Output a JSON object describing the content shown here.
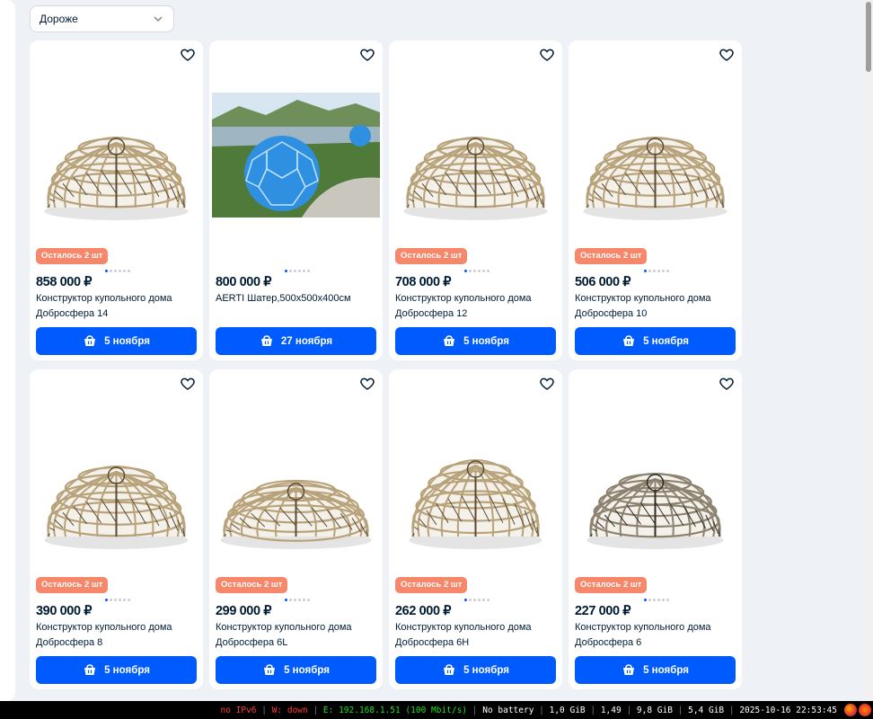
{
  "sort": {
    "selected": "Дороже"
  },
  "products": [
    {
      "price": "858 000 ₽",
      "title": "Конструктор купольного дома Добросфера 14",
      "badge": "Осталось 2 шт",
      "delivery": "5 ноября",
      "image": "dome-frame"
    },
    {
      "price": "800 000 ₽",
      "title": "AERTI Шатер,500x500x400см",
      "badge": "",
      "delivery": "27 ноября",
      "image": "glass-dome-photo"
    },
    {
      "price": "708 000 ₽",
      "title": "Конструктор купольного дома Добросфера 12",
      "badge": "Осталось 2 шт",
      "delivery": "5 ноября",
      "image": "dome-frame"
    },
    {
      "price": "506 000 ₽",
      "title": "Конструктор купольного дома Добросфера 10",
      "badge": "Осталось 2 шт",
      "delivery": "5 ноября",
      "image": "dome-frame"
    },
    {
      "price": "390 000 ₽",
      "title": "Конструктор купольного дома Добросфера 8",
      "badge": "Осталось 2 шт",
      "delivery": "5 ноября",
      "image": "dome-frame"
    },
    {
      "price": "299 000 ₽",
      "title": "Конструктор купольного дома Добросфера 6L",
      "badge": "Осталось 2 шт",
      "delivery": "5 ноября",
      "image": "dome-frame-wide"
    },
    {
      "price": "262 000 ₽",
      "title": "Конструктор купольного дома Добросфера 6H",
      "badge": "Осталось 2 шт",
      "delivery": "5 ноября",
      "image": "dome-frame-tall"
    },
    {
      "price": "227 000 ₽",
      "title": "Конструктор купольного дома Добросфера 6",
      "badge": "Осталось 2 шт",
      "delivery": "5 ноября",
      "image": "dome-frame-dark"
    }
  ],
  "statusbar": {
    "ipv6": "no IPv6",
    "wifi": "W: down",
    "ethernet": "E: 192.168.1.51 (100 Mbit/s)",
    "battery": "No battery",
    "disk": "1,0 GiB",
    "load": "1,49",
    "mem": "9,8 GiB",
    "swap": "5,4 GiB",
    "datetime": "2025-10-16 22:53:45"
  },
  "colors": {
    "accent": "#005bff",
    "badge": "#f6876b",
    "price": "#001a34"
  }
}
